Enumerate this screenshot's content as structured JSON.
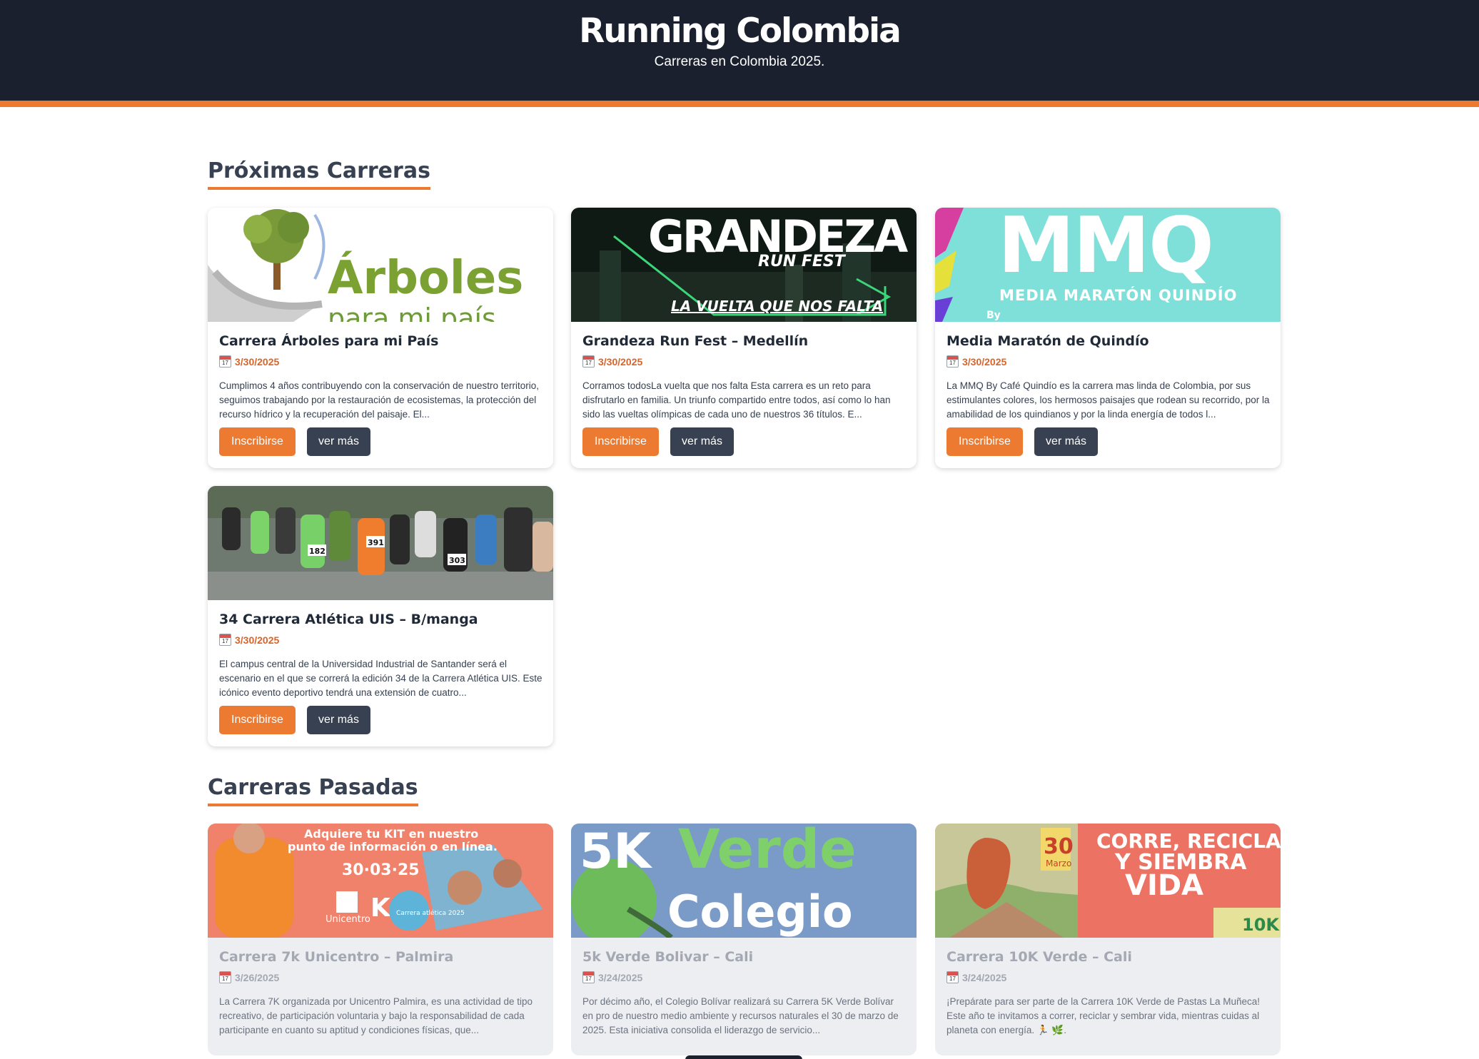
{
  "header": {
    "title": "Running Colombia",
    "subtitle": "Carreras en Colombia 2025."
  },
  "sections": {
    "upcoming_title": "Próximas Carreras",
    "past_title": "Carreras Pasadas"
  },
  "buttons": {
    "register": "Inscribirse",
    "more": "ver más"
  },
  "upcoming": [
    {
      "title": "Carrera Árboles para mi País",
      "date": "3/30/2025",
      "description": "Cumplimos 4 años contribuyendo con la conservación de nuestro territorio, seguimos trabajando por la restauración de ecosistemas, la protección del recurso hídrico y la recuperación del paisaje. El...",
      "image_text": [
        "Árboles",
        "para mi país"
      ]
    },
    {
      "title": "Grandeza Run Fest – Medellín",
      "date": "3/30/2025",
      "description": "Corramos todosLa vuelta que nos falta Esta carrera es un reto para disfrutarlo en familia. Un triunfo compartido entre todos, así como lo han sido las vueltas olímpicas de cada uno de nuestros 36 títulos. E...",
      "image_text": [
        "GRANDEZA",
        "RUN FEST",
        "LA VUELTA QUE NOS FALTA"
      ]
    },
    {
      "title": "Media Maratón de Quindío",
      "date": "3/30/2025",
      "description": "La MMQ By Café Quindío es la carrera mas linda de Colombia, por sus estimulantes colores, los hermosos paisajes que rodean su recorrido, por la amabilidad de los quindianos y por la linda energía de todos l...",
      "image_text": [
        "MMQ",
        "MEDIA MARATÓN QUINDÍO",
        "By"
      ]
    },
    {
      "title": "34 Carrera Atlética UIS – B/manga",
      "date": "3/30/2025",
      "description": "El campus central de la Universidad Industrial de Santander será el escenario en el que se correrá la edición 34 de la Carrera Atlética UIS. Este icónico evento deportivo tendrá una extensión de cuatro...",
      "image_text": [
        "182",
        "391",
        "303"
      ]
    }
  ],
  "past": [
    {
      "title": "Carrera 7k Unicentro – Palmira",
      "date": "3/26/2025",
      "description": "La Carrera 7K organizada por Unicentro Palmira, es una actividad de tipo recreativo, de participación voluntaria y bajo la responsabilidad de cada participante en cuanto su  aptitud y condiciones físicas, que...",
      "image_text": [
        "Adquiere tu KIT en nuestro",
        "punto de información o en línea.",
        "30·03·25",
        "Unicentro",
        "Carrera atlética 2025"
      ]
    },
    {
      "title": "5k Verde Bolivar – Cali",
      "date": "3/24/2025",
      "description": "Por décimo año, el Colegio Bolívar realizará su Carrera 5K Verde Bolívar en pro de nuestro medio ambiente y recursos naturales el 30 de marzo de 2025. Esta iniciativa consolida el liderazgo de servicio...",
      "image_text": [
        "5K",
        "Verde",
        "Colegio"
      ]
    },
    {
      "title": "Carrera 10K Verde – Cali",
      "date": "3/24/2025",
      "description": "¡Prepárate para ser parte de la Carrera 10K Verde de Pastas La Muñeca! Este año te invitamos a correr, reciclar y sembrar vida, mientras cuidas al planeta con energía. 🏃 🌿.",
      "image_text": [
        "30",
        "Marzo",
        "CORRE, RECICLA",
        "Y SIEMBRA",
        "VIDA",
        "10K"
      ]
    }
  ],
  "colors": {
    "header_bg": "#1a202e",
    "accent": "#ec7a31",
    "button_secondary": "#374151",
    "date": "#d9642a"
  }
}
